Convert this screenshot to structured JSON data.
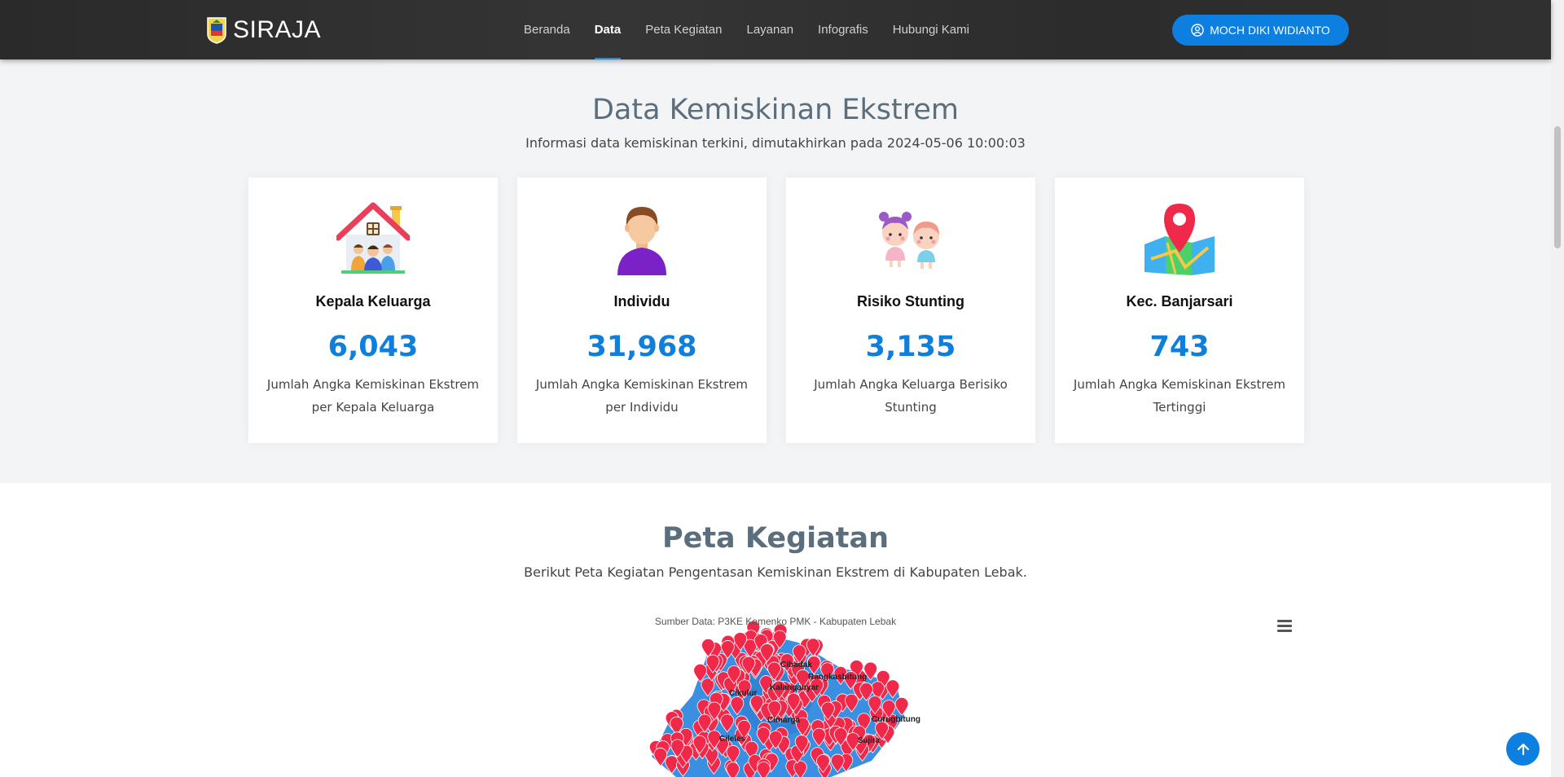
{
  "header": {
    "brand": "SIRAJA",
    "nav": [
      "Beranda",
      "Data",
      "Peta Kegiatan",
      "Layanan",
      "Infografis",
      "Hubungi Kami"
    ],
    "active_nav": "Data",
    "user_button": "MOCH DIKI WIDIANTO",
    "accent_color": "#0d7fe0"
  },
  "stats": {
    "title": "Data Kemiskinan Ekstrem",
    "subtitle": "Informasi data kemiskinan terkini, dimutakhirkan pada 2024-05-06 10:00:03",
    "cards": [
      {
        "icon": "family-house-icon",
        "title": "Kepala Keluarga",
        "value": "6,043",
        "desc": "Jumlah Angka Kemiskinan Ekstrem per Kepala Keluarga"
      },
      {
        "icon": "person-icon",
        "title": "Individu",
        "value": "31,968",
        "desc": "Jumlah Angka Kemiskinan Ekstrem per Individu"
      },
      {
        "icon": "children-icon",
        "title": "Risiko Stunting",
        "value": "3,135",
        "desc": "Jumlah Angka Keluarga Berisiko Stunting"
      },
      {
        "icon": "map-pin-icon",
        "title": "Kec. Banjarsari",
        "value": "743",
        "desc": "Jumlah Angka Kemiskinan Ekstrem Tertinggi"
      }
    ]
  },
  "map_section": {
    "title": "Peta Kegiatan",
    "subtitle": "Berikut Peta Kegiatan Pengentasan Kemiskinan Ekstrem di Kabupaten Lebak.",
    "source": "Sumber Data: P3KE Kemenko PMK - Kabupaten Lebak",
    "place_labels": [
      "Cibadak",
      "Rangkasbitung",
      "Kalanganyar",
      "Cikulur",
      "Cimarga",
      "Curugbitung",
      "Cileles",
      "Sajira"
    ],
    "menu_icon": "hamburger-menu-icon",
    "marker_color": "#f0284a",
    "region_color": "#3b8fe0"
  },
  "scroll_top_icon": "arrow-up-icon"
}
